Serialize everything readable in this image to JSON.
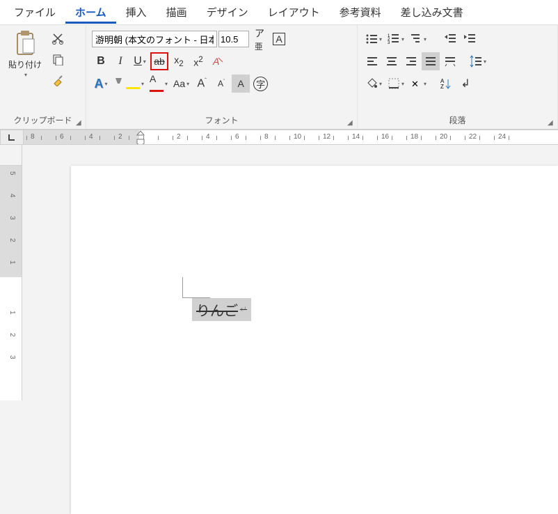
{
  "tabs": {
    "file": "ファイル",
    "home": "ホーム",
    "insert": "挿入",
    "draw": "描画",
    "design": "デザイン",
    "layout": "レイアウト",
    "references": "参考資料",
    "mailings": "差し込み文書"
  },
  "clipboard": {
    "paste": "貼り付け",
    "group_label": "クリップボード"
  },
  "font": {
    "name": "游明朝 (本文のフォント - 日本",
    "size": "10.5",
    "group_label": "フォント"
  },
  "paragraph": {
    "group_label": "段落"
  },
  "ruler": {
    "h": [
      "8",
      "6",
      "4",
      "2",
      "",
      "2",
      "4",
      "6",
      "8",
      "10",
      "12",
      "14",
      "16",
      "18",
      "20",
      "22",
      "24"
    ],
    "v_top": [
      "5",
      "4",
      "3",
      "2",
      "1"
    ],
    "v_bottom": [
      "1",
      "2",
      "3"
    ]
  },
  "document": {
    "selected_text": "りんご"
  }
}
